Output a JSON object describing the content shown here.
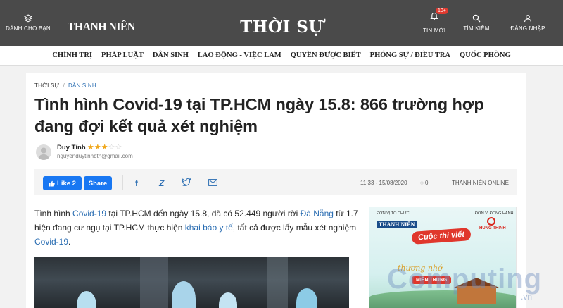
{
  "header": {
    "brands_label": "DÀNH CHO BẠN",
    "logo_text": "THANH NIÊN",
    "section_title": "THỜI SỰ",
    "notifications_label": "TIN MỚI",
    "notifications_badge": "10+",
    "search_label": "TÌM KIẾM",
    "login_label": "ĐĂNG NHẬP"
  },
  "category_nav": [
    "CHÍNH TRỊ",
    "PHÁP LUẬT",
    "DÂN SINH",
    "LAO ĐỘNG - VIỆC LÀM",
    "QUYỀN ĐƯỢC BIẾT",
    "PHÓNG SỰ / ĐIỀU TRA",
    "QUỐC PHÒNG"
  ],
  "article": {
    "breadcrumb": {
      "section": "THỜI SỰ",
      "separator": "/",
      "subsection": "DÂN SINH"
    },
    "title": "Tình hình Covid-19 tại TP.HCM ngày 15.8: 866 trường hợp đang đợi kết quả xét nghiệm",
    "author": {
      "name": "Duy Tính",
      "email": "nguyenduytinhbtn@gmail.com",
      "rating": 3,
      "rating_max": 5
    },
    "share": {
      "like_label": "Like 2",
      "share_label": "Share",
      "time": "11:33 - 15/08/2020",
      "comment_count": "0",
      "source": "THANH NIÊN ONLINE"
    },
    "lead": {
      "p1": "Tình hình ",
      "link1": "Covid-19",
      "p2": " tại TP.HCM đến ngày 15.8, đã có 52.449 người rời ",
      "link2": "Đà Nẵng",
      "p3": " từ 1.7 hiện đang cư ngụ tại TP.HCM thực hiện ",
      "link3": "khai báo y tế",
      "p4": ", tất cả được lấy mẫu xét nghiệm ",
      "link4": "Covid-19",
      "p5": "."
    }
  },
  "ad": {
    "org_label": "ĐƠN VỊ TỔ CHỨC",
    "org_logo": "THANH NIÊN",
    "sponsor_label": "ĐƠN VỊ ĐỒNG HÀNH",
    "sponsor_name": "HUNG THINH",
    "banner": "Cuộc thi viết",
    "script": "thương nhớ",
    "subtitle": "MIỀN TRUNG"
  },
  "watermark": {
    "text": "Computing",
    "sub": ".vn"
  },
  "colors": {
    "header_bg": "#4a4a4a",
    "link": "#2a6db2",
    "facebook": "#1877f2",
    "star": "#f0a71a"
  }
}
